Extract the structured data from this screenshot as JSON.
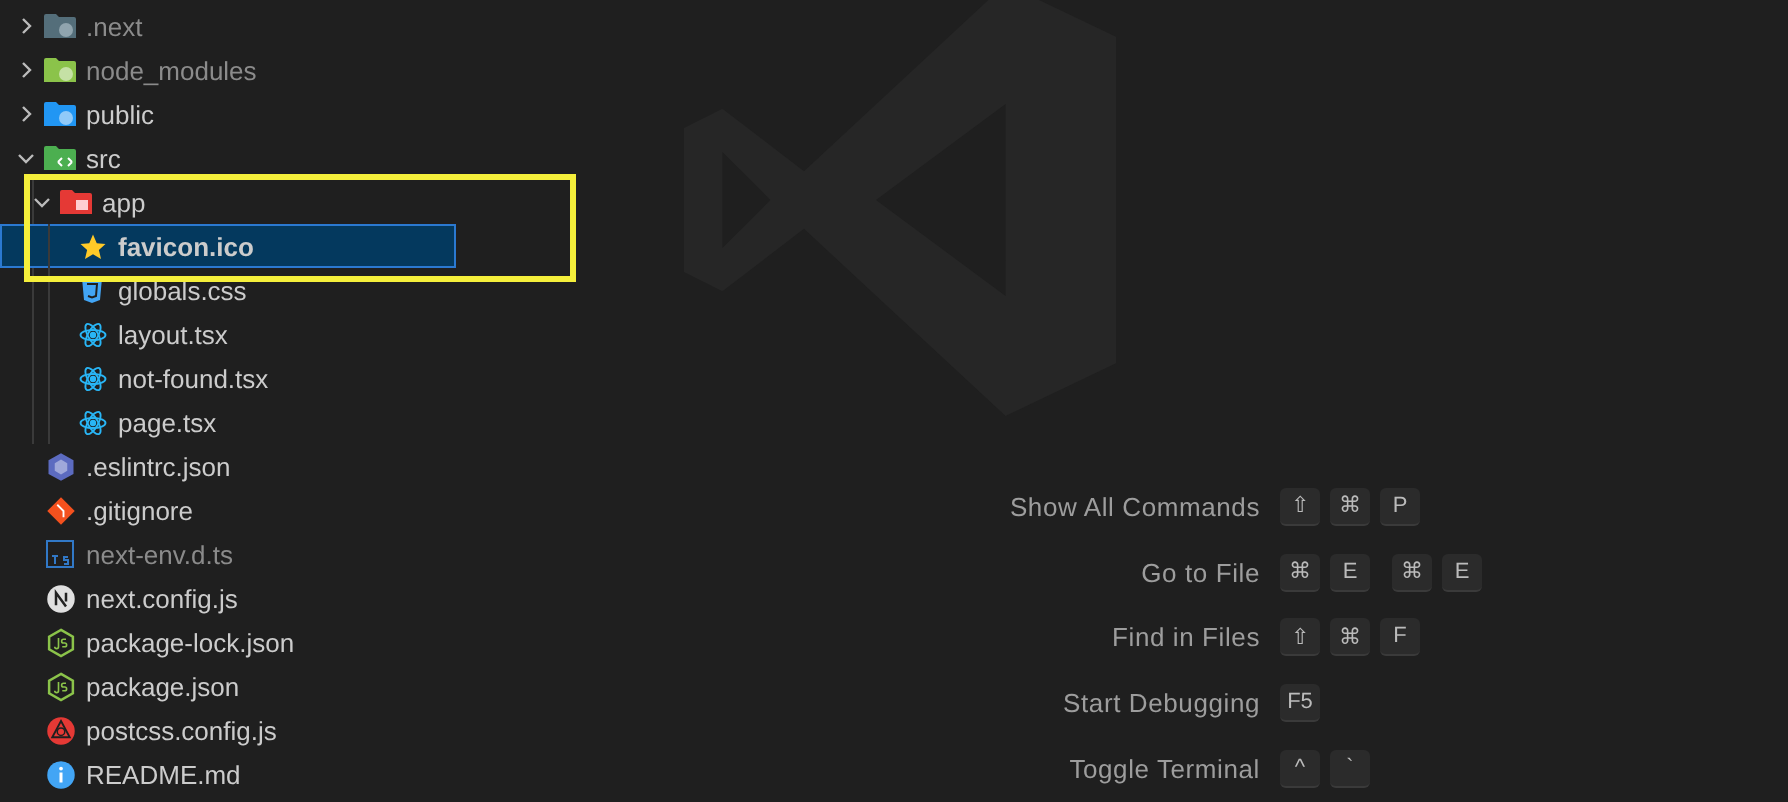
{
  "explorer": {
    "items": [
      {
        "name": ".next",
        "kind": "gearfolder",
        "expanded": false,
        "dimmed": true,
        "selected": false
      },
      {
        "name": "node_modules",
        "kind": "nodefolder",
        "expanded": false,
        "dimmed": true,
        "selected": false
      },
      {
        "name": "public",
        "kind": "globefolder",
        "expanded": false,
        "dimmed": false,
        "selected": false
      },
      {
        "name": "src",
        "kind": "codefolder",
        "expanded": true,
        "dimmed": false,
        "selected": false,
        "children": [
          {
            "name": "app",
            "kind": "gridfolder",
            "expanded": true,
            "dimmed": false,
            "selected": false,
            "children": [
              {
                "name": "favicon.ico",
                "kind": "star",
                "dimmed": false,
                "selected": true
              },
              {
                "name": "globals.css",
                "kind": "css",
                "dimmed": false,
                "selected": false
              },
              {
                "name": "layout.tsx",
                "kind": "react",
                "dimmed": false,
                "selected": false
              },
              {
                "name": "not-found.tsx",
                "kind": "react",
                "dimmed": false,
                "selected": false
              },
              {
                "name": "page.tsx",
                "kind": "react",
                "dimmed": false,
                "selected": false
              }
            ]
          }
        ]
      },
      {
        "name": ".eslintrc.json",
        "kind": "eslint",
        "dimmed": false,
        "selected": false
      },
      {
        "name": ".gitignore",
        "kind": "git",
        "dimmed": false,
        "selected": false
      },
      {
        "name": "next-env.d.ts",
        "kind": "ts",
        "dimmed": true,
        "selected": false
      },
      {
        "name": "next.config.js",
        "kind": "next",
        "dimmed": false,
        "selected": false
      },
      {
        "name": "package-lock.json",
        "kind": "node",
        "dimmed": false,
        "selected": false
      },
      {
        "name": "package.json",
        "kind": "node",
        "dimmed": false,
        "selected": false
      },
      {
        "name": "postcss.config.js",
        "kind": "postcss",
        "dimmed": false,
        "selected": false
      },
      {
        "name": "README.md",
        "kind": "info",
        "dimmed": false,
        "selected": false
      }
    ]
  },
  "annotation": {
    "kind": "highlight-box"
  },
  "shortcuts": [
    {
      "label": "Show All Commands",
      "keys": [
        "⇧",
        "⌘",
        "P"
      ]
    },
    {
      "label": "Go to File",
      "keys": [
        "⌘",
        "E",
        "⌘",
        "E"
      ]
    },
    {
      "label": "Find in Files",
      "keys": [
        "⇧",
        "⌘",
        "F"
      ]
    },
    {
      "label": "Start Debugging",
      "keys": [
        "F5"
      ]
    },
    {
      "label": "Toggle Terminal",
      "keys": [
        "^",
        "`"
      ]
    }
  ]
}
